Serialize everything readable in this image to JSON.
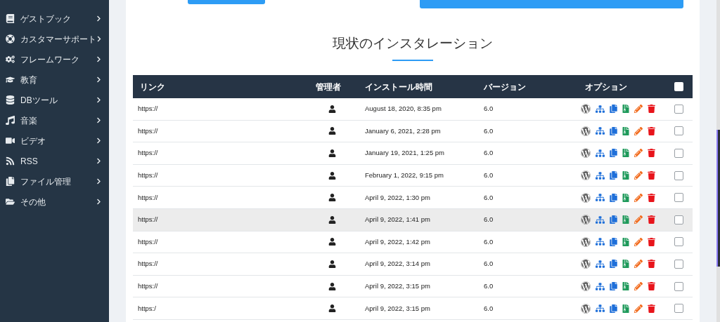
{
  "sidebar": {
    "items": [
      {
        "label": "ゲストブック"
      },
      {
        "label": "カスタマーサポート"
      },
      {
        "label": "フレームワーク"
      },
      {
        "label": "教育"
      },
      {
        "label": "DBツール"
      },
      {
        "label": "音楽"
      },
      {
        "label": "ビデオ"
      },
      {
        "label": "RSS"
      },
      {
        "label": "ファイル管理"
      },
      {
        "label": "その他"
      }
    ]
  },
  "section": {
    "title": "現状のインスタレーション"
  },
  "table": {
    "columns": [
      "リンク",
      "管理者",
      "インストール時間",
      "バージョン",
      "オプション"
    ],
    "select_all": {
      "checked": false
    },
    "rows": [
      {
        "link": "https://",
        "time": "August 18, 2020, 8:35 pm",
        "version": "6.0",
        "highlighted": false,
        "checked": false
      },
      {
        "link": "https://",
        "time": "January 6, 2021, 2:28 pm",
        "version": "6.0",
        "highlighted": false,
        "checked": false
      },
      {
        "link": "https://",
        "time": "January 19, 2021, 1:25 pm",
        "version": "6.0",
        "highlighted": false,
        "checked": false
      },
      {
        "link": "https://",
        "time": "February 1, 2022, 9:15 pm",
        "version": "6.0",
        "highlighted": false,
        "checked": false
      },
      {
        "link": "https://",
        "time": "April 9, 2022, 1:30 pm",
        "version": "6.0",
        "highlighted": false,
        "checked": false
      },
      {
        "link": "https://",
        "time": "April 9, 2022, 1:41 pm",
        "version": "6.0",
        "highlighted": true,
        "checked": false
      },
      {
        "link": "https://",
        "time": "April 9, 2022, 1:42 pm",
        "version": "6.0",
        "highlighted": false,
        "checked": false
      },
      {
        "link": "https://",
        "time": "April 9, 2022, 3:14 pm",
        "version": "6.0",
        "highlighted": false,
        "checked": false
      },
      {
        "link": "https://",
        "time": "April 9, 2022, 3:15 pm",
        "version": "6.0",
        "highlighted": false,
        "checked": false
      },
      {
        "link": "https:/",
        "time": "April 9, 2022, 3:15 pm",
        "version": "6.0",
        "highlighted": false,
        "checked": false
      }
    ]
  }
}
